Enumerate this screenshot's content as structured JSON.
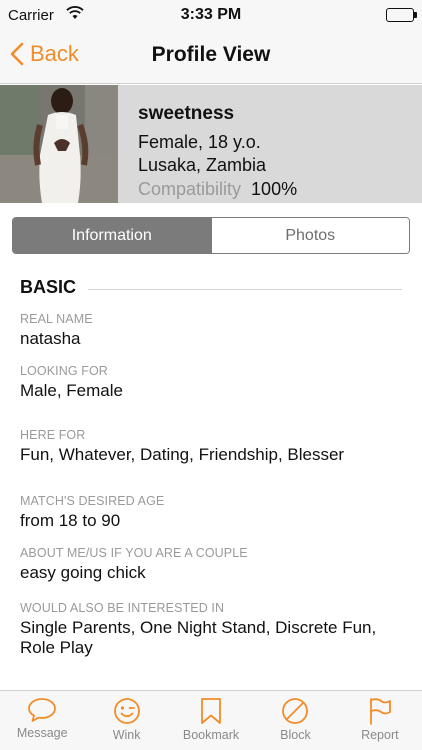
{
  "status_bar": {
    "carrier": "Carrier",
    "time": "3:33 PM"
  },
  "nav": {
    "back_label": "Back",
    "title": "Profile View"
  },
  "profile": {
    "username": "sweetness",
    "gender_age": "Female, 18 y.o.",
    "location": "Lusaka, Zambia",
    "compatibility_label": "Compatibility",
    "compatibility_value": "100%"
  },
  "tabs": {
    "information": "Information",
    "photos": "Photos"
  },
  "section": {
    "title": "BASIC"
  },
  "fields": [
    {
      "label": "REAL NAME",
      "value": "natasha"
    },
    {
      "label": "LOOKING FOR",
      "value": "Male, Female"
    },
    {
      "label": "HERE FOR",
      "value": "Fun, Whatever, Dating, Friendship, Blesser"
    },
    {
      "label": "MATCH'S DESIRED AGE",
      "value": "from 18 to 90"
    },
    {
      "label": "ABOUT ME/US IF YOU ARE A COUPLE",
      "value": "easy going chick"
    },
    {
      "label": "WOULD ALSO BE INTERESTED IN",
      "value": "Single Parents, One Night Stand, Discrete Fun, Role Play"
    }
  ],
  "tab_bar": {
    "message": "Message",
    "wink": "Wink",
    "bookmark": "Bookmark",
    "block": "Block",
    "report": "Report"
  },
  "colors": {
    "accent": "#f28c28",
    "header_bg": "#d9d9d9",
    "segment_active": "#7b7b7b"
  }
}
